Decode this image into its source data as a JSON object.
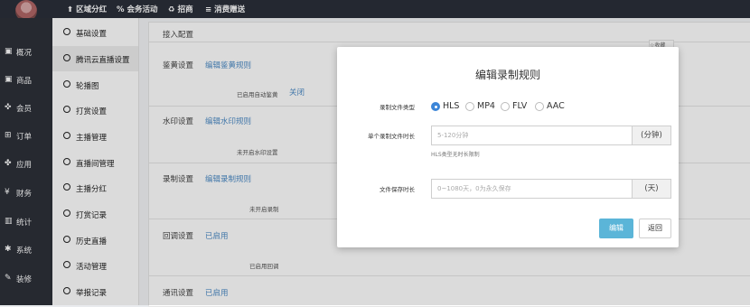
{
  "topnav": [
    {
      "icon": "pin-icon",
      "glyph": "⬆",
      "label": "区域分红"
    },
    {
      "icon": "percent-icon",
      "glyph": "%",
      "label": "会务活动"
    },
    {
      "icon": "refresh-icon",
      "glyph": "♻",
      "label": "招商"
    },
    {
      "icon": "list-icon",
      "glyph": "≡",
      "label": "消费赠送"
    }
  ],
  "sidebar": {
    "items": [
      {
        "icon": "overview-icon",
        "glyph": "▣",
        "label": "概况"
      },
      {
        "icon": "product-icon",
        "glyph": "▣",
        "label": "商品"
      },
      {
        "icon": "member-icon",
        "glyph": "✜",
        "label": "会员"
      },
      {
        "icon": "cart-icon",
        "glyph": "⊞",
        "label": "订单"
      },
      {
        "icon": "apps-icon",
        "glyph": "✤",
        "label": "应用"
      },
      {
        "icon": "finance-icon",
        "glyph": "¥",
        "label": "财务"
      },
      {
        "icon": "stats-icon",
        "glyph": "▥",
        "label": "统计"
      },
      {
        "icon": "system-icon",
        "glyph": "✱",
        "label": "系统"
      },
      {
        "icon": "decorate-icon",
        "glyph": "✎",
        "label": "装修"
      }
    ]
  },
  "submenu": {
    "items": [
      {
        "label": "基础设置"
      },
      {
        "label": "腾讯云直播设置"
      },
      {
        "label": "轮播图"
      },
      {
        "label": "打赏设置"
      },
      {
        "label": "主播管理"
      },
      {
        "label": "直播间管理"
      },
      {
        "label": "主播分红"
      },
      {
        "label": "打赏记录"
      },
      {
        "label": "历史直播"
      },
      {
        "label": "活动管理"
      },
      {
        "label": "举报记录"
      }
    ],
    "active_index": 1
  },
  "main": {
    "header": "接入配置",
    "favorite_label": "☆收藏",
    "sections": [
      {
        "title": "鉴黄设置",
        "link": "编辑鉴黄规则",
        "status_text": "已启用自动鉴黄",
        "status_link": "关闭"
      },
      {
        "title": "水印设置",
        "link": "编辑水印规则",
        "status_text": "未开启水印设置"
      },
      {
        "title": "录制设置",
        "link": "编辑录制规则",
        "status_text": "未开启录制"
      },
      {
        "title": "回调设置",
        "link": "已启用",
        "status_text": "已启用回调"
      },
      {
        "title": "通讯设置",
        "link": "已启用"
      }
    ]
  },
  "modal": {
    "title": "编辑录制规则",
    "file_type_label": "录制文件类型",
    "file_types": [
      "HLS",
      "MP4",
      "FLV",
      "AAC"
    ],
    "selected_file_type": "HLS",
    "duration_label": "单个录制文件时长",
    "duration_placeholder": "5-120分钟",
    "duration_unit": "(分钟)",
    "duration_hint": "HLS类型无时长限制",
    "retention_label": "文件保存时长",
    "retention_placeholder": "0~1080天，0为永久保存",
    "retention_unit": "(天)",
    "edit_button": "编辑",
    "back_button": "返回"
  },
  "colors": {
    "accent": "#5bb5d8",
    "link": "#4e8cc6",
    "sidebar_bg": "#2d3039",
    "radio_selected": "#3d86d8"
  }
}
